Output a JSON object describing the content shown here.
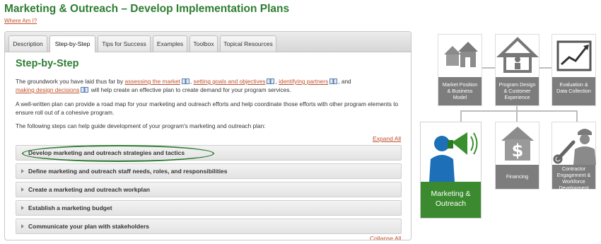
{
  "header": {
    "title": "Marketing & Outreach – Develop Implementation Plans",
    "where_am_i": "Where Am I?"
  },
  "tabs": [
    {
      "label": "Description"
    },
    {
      "label": "Step-by-Step",
      "active": true
    },
    {
      "label": "Tips for Success"
    },
    {
      "label": "Examples"
    },
    {
      "label": "Toolbox"
    },
    {
      "label": "Topical Resources"
    }
  ],
  "content": {
    "heading": "Step-by-Step",
    "para1": {
      "t1": "The groundwork you have laid thus far by ",
      "link1": "assessing the market",
      "t2": ", ",
      "link2": "setting goals and objectives",
      "t3": ", ",
      "link3": "identifying partners",
      "t4": ", and",
      "link4": "making design decisions",
      "t5": " will help create an effective plan to create demand for your program services."
    },
    "para2": "A well-written plan can provide a road map for your marketing and outreach efforts and help coordinate those efforts with other program elements to ensure roll out of a cohesive program.",
    "para3": "The following steps can help guide development of your program's marketing and outreach plan:",
    "expand_all": "Expand All",
    "collapse_all": "Collapse All",
    "steps": [
      {
        "label": "Develop marketing and outreach strategies and tactics"
      },
      {
        "label": "Define marketing and outreach staff needs, roles, and responsibilities"
      },
      {
        "label": "Create a marketing and outreach workplan"
      },
      {
        "label": "Establish a marketing budget"
      },
      {
        "label": "Communicate your plan with stakeholders"
      }
    ]
  },
  "diagram": {
    "cards": [
      {
        "id": "market-position",
        "caption": "Market Position & Business Model",
        "icon": "houses-icon"
      },
      {
        "id": "program-design",
        "caption": "Program Design & Customer Experience",
        "icon": "house-person-icon"
      },
      {
        "id": "evaluation",
        "caption": "Evaluation & Data Collection",
        "icon": "chart-icon"
      },
      {
        "id": "marketing-outreach",
        "caption": "Marketing & Outreach",
        "icon": "megaphone-person-icon"
      },
      {
        "id": "financing",
        "caption": "Financing",
        "icon": "dollar-house-icon"
      },
      {
        "id": "contractor",
        "caption": "Contractor Engagement & Workforce Development",
        "icon": "worker-wrench-icon"
      }
    ],
    "colors": {
      "active_card": "#3b8a2f",
      "inactive_card": "#7d7d7d",
      "accent_green": "#2e7d32",
      "link": "#c0502b"
    }
  }
}
